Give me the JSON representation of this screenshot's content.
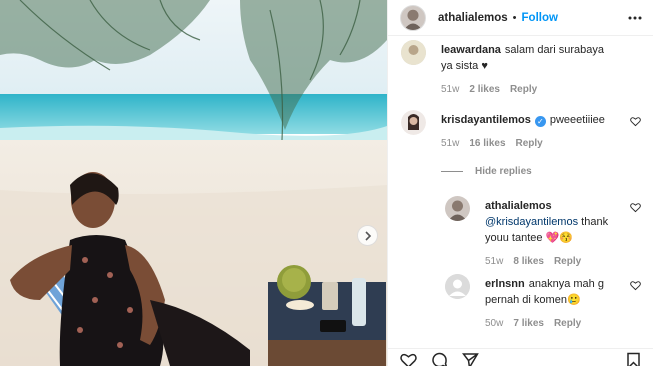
{
  "post": {
    "author": "athalialemos",
    "separator": "•",
    "follow_label": "Follow"
  },
  "icons": {
    "more": "more-options-icon",
    "next": "chevron-right-icon",
    "heart": "heart-outline-icon",
    "verified": "verified-badge-icon"
  },
  "colors": {
    "accent": "#0095f6",
    "verified": "#3897f0",
    "secondary_text": "#8e8e8e",
    "mention": "#00376b"
  },
  "comments": [
    {
      "username": "leawardana",
      "text": "salam dari surabaya ya sista ♥",
      "age": "51w",
      "likes": "2 likes",
      "reply": "Reply"
    },
    {
      "username": "krisdayantilemos",
      "verified": true,
      "text": "pweeetiiiee",
      "age": "51w",
      "likes": "16 likes",
      "reply": "Reply"
    }
  ],
  "hide_replies_label": "Hide replies",
  "replies": [
    {
      "username": "athalialemos",
      "mention": "@krisdayantilemos",
      "text": "thank youu tantee 💖😚",
      "age": "51w",
      "likes": "8 likes",
      "reply": "Reply"
    },
    {
      "username": "erlnsnn",
      "text": "anaknya mah g pernah di komen🥲",
      "age": "50w",
      "likes": "7 likes",
      "reply": "Reply"
    }
  ],
  "footer_icons": [
    "heart-outline-icon",
    "comment-icon",
    "share-icon",
    "bookmark-icon"
  ]
}
